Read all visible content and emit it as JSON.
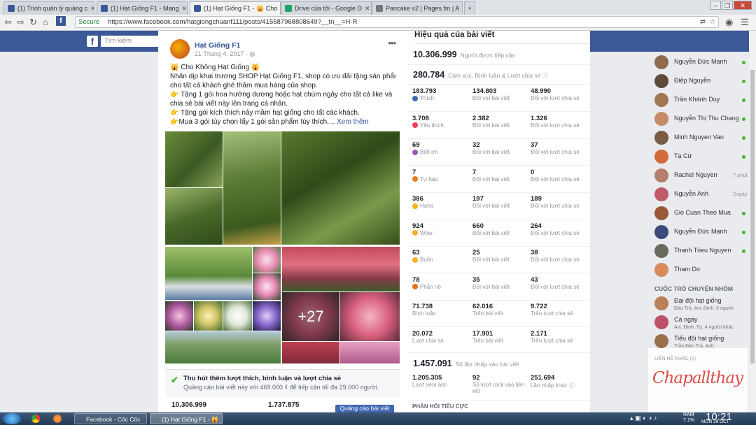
{
  "browser": {
    "tabs": [
      {
        "label": "(1) Trình quản lý quảng c",
        "color": "#3b5998"
      },
      {
        "label": "(1) Hạt Giống F1 - Mạng",
        "color": "#3b5998"
      },
      {
        "label": "(1) Hạt Giống F1 - 🙀 Cho",
        "color": "#3b5998",
        "active": true
      },
      {
        "label": "Drive của tôi - Google D",
        "color": "#1fa463"
      },
      {
        "label": "Pancake v2 | Pages.fm | A",
        "color": "#777777"
      }
    ],
    "secure_label": "Secure",
    "url": "https://www.facebook.com/hatgiongchuanf111/posts/415587968808649?__tn__=H-R"
  },
  "facebook": {
    "logo": "f",
    "search_placeholder": "Tìm kiếm"
  },
  "post": {
    "page_name": "Hạt Giống F1",
    "date": "21 Tháng 4, 2017 · ",
    "lines": [
      "🙀 Cho Không Hạt Giống 🙀",
      "Nhân dịp khai trương SHOP Hạt Giống F1, shop có ưu đãi tặng sản phẩm",
      "cho tất cả khách ghé thăm mua hàng của shop.",
      "👉 Tặng 1 gói hoa hướng dương hoặc hạt chùm ngây cho tất cả like và",
      "chia sẻ bài viết này lên trang cá nhân.",
      "👉 Tặng gói kích thích nảy mầm hạt giống cho tất các khách.",
      "👉Mua 3 gói tùy chọn lấy 1 gói sản phẩm tùy thích.... "
    ],
    "see_more": "Xem thêm",
    "more_photos": "+27",
    "promo_title": "Thu hút thêm lượt thích, bình luận và lượt chia sẻ",
    "promo_sub": "Quảng cáo bài viết này với 469.000 ₫ để tiếp cận tối đa 29.000 người.",
    "stat_reach": "10.306.999",
    "stat_engaged": "1.737.875",
    "boost_button": "Quảng cáo bài viết"
  },
  "insights": {
    "title": "Hiệu quả của bài viết",
    "reach_value": "10.306.999",
    "reach_label": "Người được tiếp cận",
    "engage_value": "280.784",
    "engage_label": "Cảm xúc, Bình luận & Lượt chia sẻ ⓘ",
    "rows": [
      {
        "icon_color": "#4267b2",
        "c1v": "183.793",
        "c1l": "Thích",
        "c2v": "134.803",
        "c2l": "Đối với bài viết",
        "c3v": "48.990",
        "c3l": "Đối với lượt chia sẻ"
      },
      {
        "icon_color": "#f33e58",
        "c1v": "3.708",
        "c1l": "Yêu thích",
        "c2v": "2.382",
        "c2l": "Đối với bài viết",
        "c3v": "1.326",
        "c3l": "Đối với lượt chia sẻ"
      },
      {
        "icon_color": "#9b59b6",
        "c1v": "69",
        "c1l": "Biết ơn",
        "c2v": "32",
        "c2l": "Đối với bài viết",
        "c3v": "37",
        "c3l": "Đối với lượt chia sẻ"
      },
      {
        "icon_color": "#e67e22",
        "c1v": "7",
        "c1l": "Tự hào",
        "c2v": "7",
        "c2l": "Đối với bài viết",
        "c3v": "0",
        "c3l": "Đối với lượt chia sẻ"
      },
      {
        "icon_color": "#f7b125",
        "c1v": "386",
        "c1l": "Haha",
        "c2v": "197",
        "c2l": "Đối với bài viết",
        "c3v": "189",
        "c3l": "Đối với lượt chia sẻ"
      },
      {
        "icon_color": "#f7b125",
        "c1v": "924",
        "c1l": "Wow",
        "c2v": "660",
        "c2l": "Đối với bài viết",
        "c3v": "264",
        "c3l": "Đối với lượt chia sẻ"
      },
      {
        "icon_color": "#f7b125",
        "c1v": "63",
        "c1l": "Buồn",
        "c2v": "25",
        "c2l": "Đối với bài viết",
        "c3v": "38",
        "c3l": "Đối với lượt chia sẻ"
      },
      {
        "icon_color": "#e9710f",
        "c1v": "78",
        "c1l": "Phẫn nộ",
        "c2v": "35",
        "c2l": "Đối với bài viết",
        "c3v": "43",
        "c3l": "Đối với lượt chia sẻ"
      },
      {
        "icon_color": "",
        "c1v": "71.738",
        "c1l": "Bình luận",
        "c2v": "62.016",
        "c2l": "Trên bài viết",
        "c3v": "9.722",
        "c3l": "Trên lượt chia sẻ"
      },
      {
        "icon_color": "",
        "c1v": "20.072",
        "c1l": "Lượt chia sẻ",
        "c2v": "17.901",
        "c2l": "Trên bài viết",
        "c3v": "2.171",
        "c3l": "Trên lượt chia sẻ"
      }
    ],
    "clicks_value": "1.457.091",
    "clicks_label": "Số lần nhấp vào bài viết",
    "c_photo_v": "1.205.305",
    "c_photo_l": "Lượt xem ảnh",
    "c_link_v": "92",
    "c_link_l": "Số lượt click vào liên kết",
    "c_other_v": "251.694",
    "c_other_l": "Lần nhấp khác ⓘ",
    "negative_title": "PHẢN HỒI TIÊU CỰC"
  },
  "chat": {
    "contacts": [
      {
        "name": "Nguyễn Đức Mạnh",
        "online": true,
        "color": "#8e6b4d"
      },
      {
        "name": "Điệp Nguyễn",
        "online": true,
        "color": "#5d4a3a"
      },
      {
        "name": "Trần Khánh Duy",
        "online": true,
        "color": "#a07855"
      },
      {
        "name": "Nguyễn Thị Thu Chang",
        "online": true,
        "color": "#c48a6a"
      },
      {
        "name": "Minh Nguyen Van",
        "online": true,
        "color": "#7a5b43"
      },
      {
        "name": "Tạ Cừ",
        "online": true,
        "color": "#d26a3a"
      },
      {
        "name": "Rachel Nguyen",
        "ago": "7 phút",
        "color": "#b57d6b"
      },
      {
        "name": "Nguyễn Anh",
        "ago": "2ngày",
        "color": "#c25a6a"
      },
      {
        "name": "Gio Cuan Theo Mua",
        "online": true,
        "color": "#9a5a3a"
      },
      {
        "name": "Nguyễn Đức Mạnh",
        "online": true,
        "color": "#3b4a7a"
      },
      {
        "name": "Thanh Trieu Nguyen",
        "online": true,
        "color": "#6a6a5a"
      },
      {
        "name": "Tham Do",
        "color": "#d88a5a"
      }
    ],
    "groups_title": "CUỘC TRÒ CHUYỆN NHÓM",
    "groups": [
      {
        "name": "Đại đội hạt giống",
        "sub": "Đào Trà, Avi, Đinh, 9 người",
        "color": "#b9805a"
      },
      {
        "name": "Cá ngáy",
        "sub": "Avi, Đinh, Tạ, 4 người khác",
        "color": "#c0506a"
      },
      {
        "name": "Tiểu đội hạt giống",
        "sub": "Trần Đào Trà, Anh",
        "color": "#9a704a"
      }
    ]
  },
  "watermark": {
    "label": "LIÊN HỆ KHÁC (1)",
    "signature": "Chapallthay"
  },
  "taskbar": {
    "items": [
      {
        "label": "Facebook - Cốc Cốc"
      },
      {
        "label": "(1) Hạt Giống F1 - 🙀 ..."
      }
    ],
    "ram_label": "RAM",
    "ram_value": "7.1%",
    "time": "10:21",
    "date": "MON 28 OCT"
  }
}
